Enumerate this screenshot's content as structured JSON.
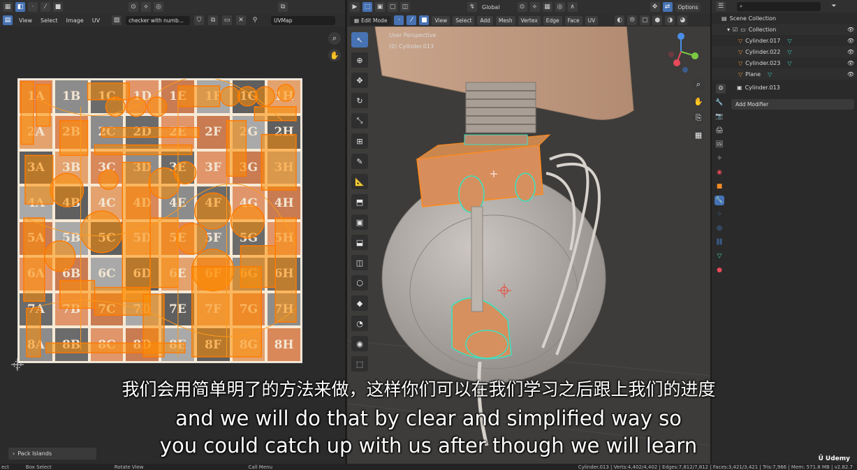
{
  "uv_editor": {
    "menus": [
      "View",
      "Select",
      "Image",
      "UV"
    ],
    "image_name": "checker with numb...",
    "uv_map": "UVMap",
    "grid_rows": [
      [
        "1A",
        "1B",
        "1C",
        "1D",
        "1E",
        "1F",
        "1G",
        "1H"
      ],
      [
        "2A",
        "2B",
        "2C",
        "2D",
        "2E",
        "2F",
        "2G",
        "2H"
      ],
      [
        "3A",
        "3B",
        "3C",
        "3D",
        "3E",
        "3F",
        "3G",
        "3H"
      ],
      [
        "4A",
        "4B",
        "4C",
        "4D",
        "4E",
        "4F",
        "4G",
        "4H"
      ],
      [
        "5A",
        "5B",
        "5C",
        "5D",
        "5E",
        "5F",
        "5G",
        "5H"
      ],
      [
        "6A",
        "6B",
        "6C",
        "6D",
        "6E",
        "6F",
        "6G",
        "6H"
      ],
      [
        "7A",
        "7B",
        "7C",
        "7D",
        "7E",
        "7F",
        "7G",
        "7H"
      ],
      [
        "8A",
        "8B",
        "8C",
        "8D",
        "8E",
        "8F",
        "8G",
        "8H"
      ]
    ],
    "cell_colors": [
      "#d9885a",
      "#a9a9a9",
      "#6b6b6b",
      "#e3a26e",
      "#c97b52",
      "#8c8c8c",
      "#5f5f5f",
      "#e0956a"
    ],
    "last_op": "Pack Islands"
  },
  "viewport": {
    "mode": "Edit Mode",
    "orientation": "Global",
    "menus": [
      "View",
      "Select",
      "Add",
      "Mesh",
      "Vertex",
      "Edge",
      "Face",
      "UV"
    ],
    "options": "Options",
    "perspective": "User Perspective",
    "object_label": "(0) Cylinder.013"
  },
  "outliner": {
    "scene": "Scene Collection",
    "collection": "Collection",
    "objects": [
      "Cylinder.017",
      "Cylinder.022",
      "Cylinder.023",
      "Plane"
    ]
  },
  "properties": {
    "object": "Cylinder.013",
    "add_modifier": "Add Modifier"
  },
  "status": {
    "left_items": [
      "ect",
      "Box Select",
      "Rotate View",
      "Call Menu"
    ],
    "stats": "Cylinder.013 | Verts:4,402/4,402 | Edges:7,812/7,812 | Faces:3,421/3,421 | Tris:7,966 | Mem: 571.8 MB | v2.82.7"
  },
  "subtitles": {
    "zh": "我们会用简单明了的方法来做，这样你们可以在我们学习之后跟上我们的进度",
    "en1": "and we will do that by clear and simplified way so",
    "en2": "you could catch up with us after though we will learn"
  },
  "watermark": "Udemy",
  "colors": {
    "accent": "#4772b3",
    "uv_orange": "#ff8c00",
    "selection_cyan": "#3ee0c0"
  }
}
